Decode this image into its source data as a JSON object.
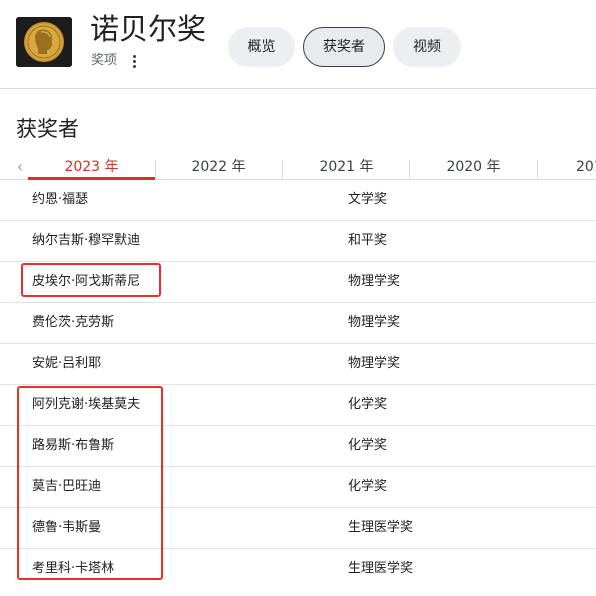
{
  "header": {
    "title": "诺贝尔奖",
    "subtitle": "奖项",
    "tabs": [
      {
        "label": "概览",
        "selected": false
      },
      {
        "label": "获奖者",
        "selected": true
      },
      {
        "label": "视频",
        "selected": false
      }
    ]
  },
  "section": {
    "title": "获奖者"
  },
  "year_tabs": {
    "items": [
      {
        "label": "2023 年",
        "selected": true
      },
      {
        "label": "2022 年",
        "selected": false
      },
      {
        "label": "2021 年",
        "selected": false
      },
      {
        "label": "2020 年",
        "selected": false
      },
      {
        "label": "201",
        "selected": false
      }
    ]
  },
  "laureates": [
    {
      "name": "约恩·福瑟",
      "award": "文学奖"
    },
    {
      "name": "纳尔吉斯·穆罕默迪",
      "award": "和平奖"
    },
    {
      "name": "皮埃尔·阿戈斯蒂尼",
      "award": "物理学奖"
    },
    {
      "name": "费伦茨·克劳斯",
      "award": "物理学奖"
    },
    {
      "name": "安妮·吕利耶",
      "award": "物理学奖"
    },
    {
      "name": "阿列克谢·埃基莫夫",
      "award": "化学奖"
    },
    {
      "name": "路易斯·布鲁斯",
      "award": "化学奖"
    },
    {
      "name": "莫吉·巴旺迪",
      "award": "化学奖"
    },
    {
      "name": "德鲁·韦斯曼",
      "award": "生理医学奖"
    },
    {
      "name": "考里科·卡塔林",
      "award": "生理医学奖"
    }
  ],
  "colors": {
    "accent": "#d93025",
    "highlight_box": "#e5322d",
    "chip_bg": "#eceef1",
    "divider": "#dadce0"
  },
  "icons": {
    "logo": "nobel-medal-icon",
    "menu": "more-vertical-icon",
    "prev": "chevron-left-icon"
  }
}
